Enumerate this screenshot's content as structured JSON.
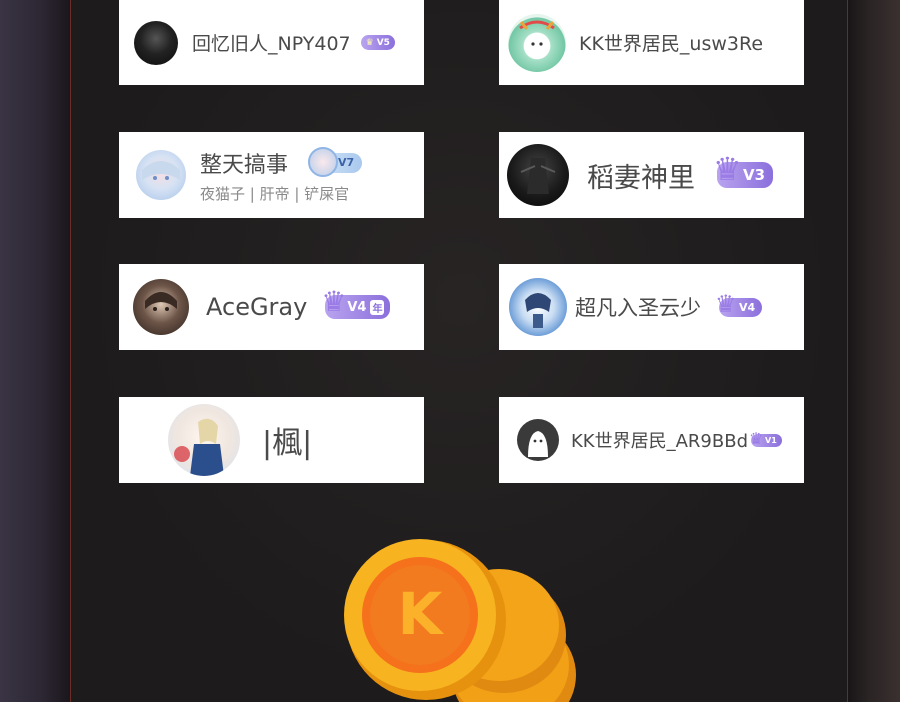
{
  "users": [
    {
      "name": "回忆旧人_NPY407",
      "level": "V5"
    },
    {
      "name": "KK世界居民_usw3Re"
    },
    {
      "name": "整天搞事",
      "subtitle": "夜猫子 | 肝帝 | 铲屎官",
      "level": "V7"
    },
    {
      "name": "稻妻神里",
      "level": "V3"
    },
    {
      "name": "AceGray",
      "level": "V4",
      "extra": "年"
    },
    {
      "name": "超凡入圣云少",
      "level": "V4"
    },
    {
      "name": "|楓|"
    },
    {
      "name": "KK世界居民_AR9BBd",
      "level": "V1"
    }
  ],
  "coin_logo": "K",
  "colors": {
    "badge_start": "#b9a4ef",
    "badge_end": "#8b6fdc",
    "coin": "#f4a418",
    "coin_face": "#f5711c"
  },
  "icons": [
    "user-avatar",
    "crown-icon",
    "coin-icon"
  ]
}
